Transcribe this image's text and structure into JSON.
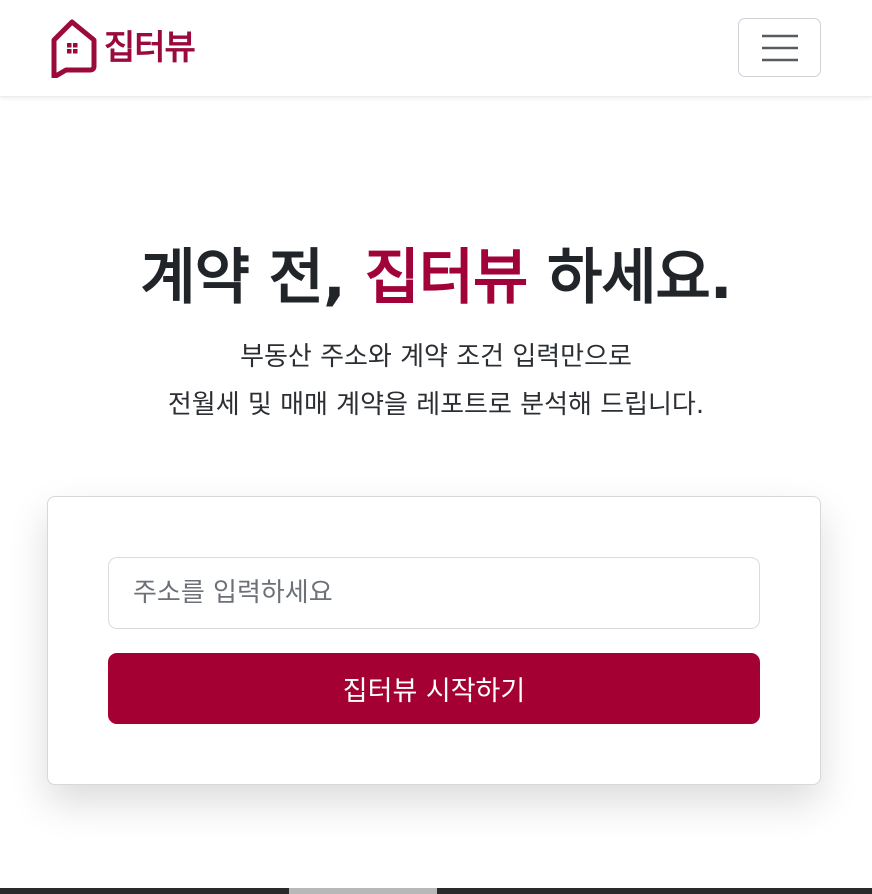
{
  "brand": {
    "name": "집터뷰",
    "logo_icon": "house-chat-icon",
    "color": "#9b0a3c"
  },
  "navbar": {
    "menu_icon": "hamburger-menu-icon"
  },
  "hero": {
    "title_prefix": "계약 전, ",
    "title_accent": "집터뷰",
    "title_suffix": " 하세요.",
    "subtitle_line1": "부동산 주소와 계약 조건 입력만으로",
    "subtitle_line2": "전월세 및 매매 계약을 레포트로 분석해 드립니다.",
    "accent_color": "#a1023a"
  },
  "search": {
    "placeholder": "주소를 입력하세요",
    "value": "",
    "button_label": "집터뷰 시작하기",
    "button_color": "#a50034"
  }
}
